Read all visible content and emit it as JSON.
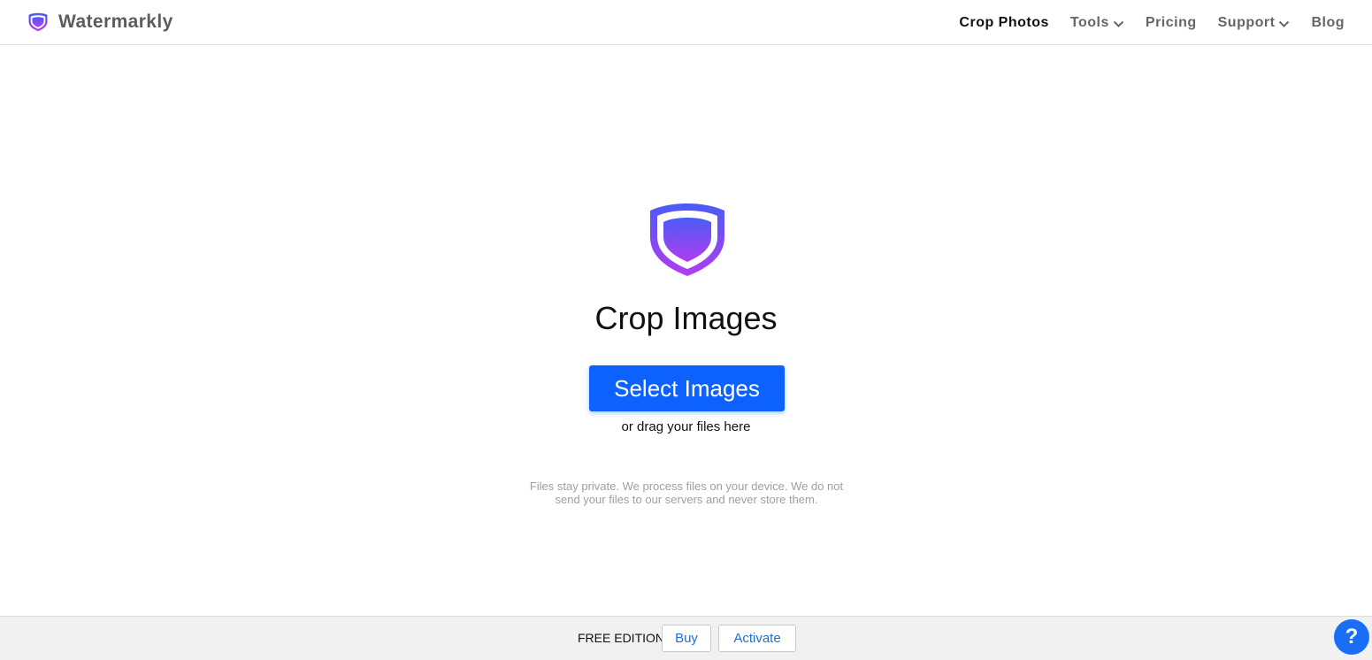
{
  "header": {
    "brand_name": "Watermarkly",
    "nav": [
      {
        "label": "Crop Photos",
        "active": true,
        "has_dropdown": false
      },
      {
        "label": "Tools",
        "active": false,
        "has_dropdown": true
      },
      {
        "label": "Pricing",
        "active": false,
        "has_dropdown": false
      },
      {
        "label": "Support",
        "active": false,
        "has_dropdown": true
      },
      {
        "label": "Blog",
        "active": false,
        "has_dropdown": false
      }
    ]
  },
  "main": {
    "title": "Crop Images",
    "select_button_label": "Select Images",
    "drag_hint": "or drag your files here",
    "privacy_note": "Files stay private. We process files on your device. We do not send your files to our servers and never store them."
  },
  "footer": {
    "edition_label": "FREE EDITION",
    "buy_label": "Buy",
    "activate_label": "Activate",
    "help_label": "?"
  },
  "colors": {
    "primary_button": "#0d62ff",
    "logo_gradient_top": "#4a5cf5",
    "logo_gradient_bottom": "#b23cf0",
    "link_blue": "#1f6fd6",
    "help_button": "#1a6ef5"
  },
  "icons": {
    "brand": "shield-logo-icon",
    "dropdown": "chevron-down-icon",
    "help": "question-icon"
  }
}
